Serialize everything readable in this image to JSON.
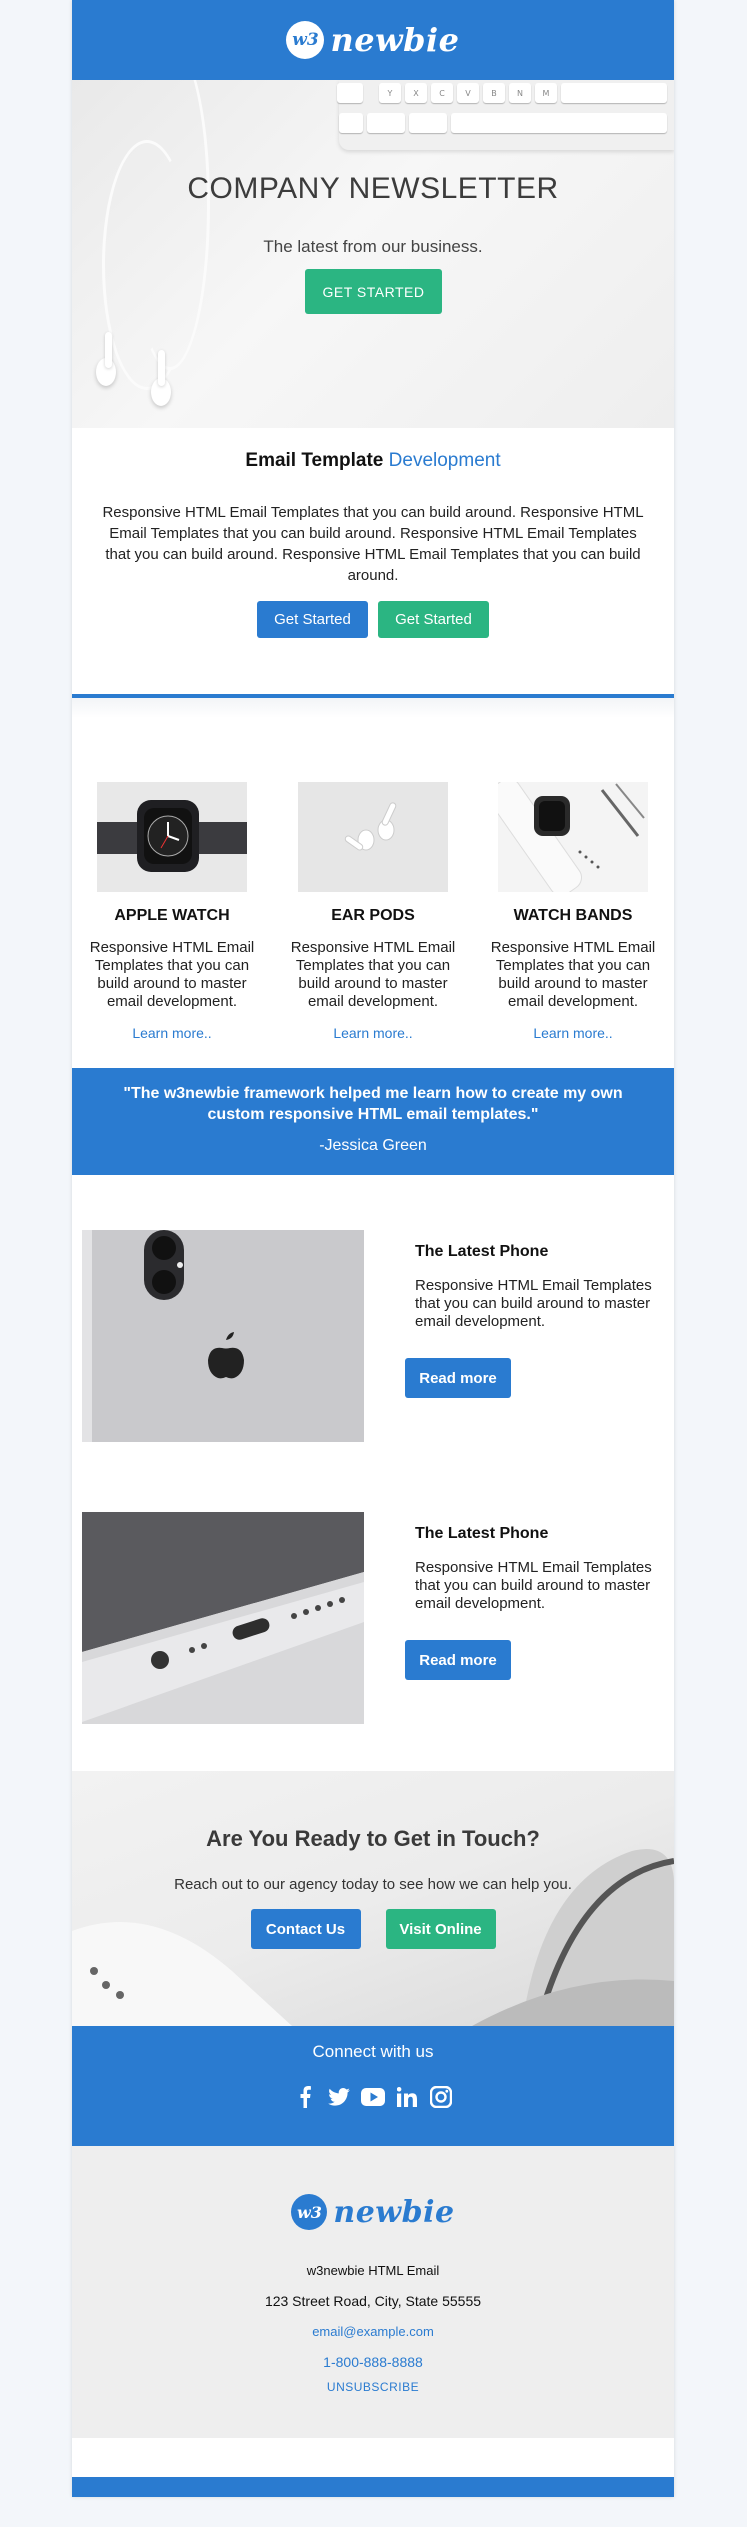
{
  "brand": {
    "logo_badge": "w3",
    "logo_text": "newbie"
  },
  "hero": {
    "title": "COMPANY NEWSLETTER",
    "subtitle": "The latest from our business.",
    "cta": "GET STARTED",
    "keys": [
      "",
      "Y",
      "X",
      "C",
      "V",
      "B",
      "N",
      "M"
    ]
  },
  "intro": {
    "title": "Email Template",
    "title_accent": "Development",
    "body": "Responsive HTML Email Templates that you can build around. Responsive HTML Email Templates that you can build around. Responsive HTML Email Templates that you can build around. Responsive HTML Email Templates that you can build around.",
    "btn_primary": "Get Started",
    "btn_secondary": "Get Started"
  },
  "products": [
    {
      "name": "APPLE WATCH",
      "desc": "Responsive HTML Email Templates that you can build around to master email development.",
      "link": "Learn more.."
    },
    {
      "name": "EAR PODS",
      "desc": "Responsive HTML Email Templates that you can build around to master email development.",
      "link": "Learn more.."
    },
    {
      "name": "WATCH BANDS",
      "desc": "Responsive HTML Email Templates that you can build around to master email development.",
      "link": "Learn more.."
    }
  ],
  "testimonial": {
    "quote": "\"The w3newbie framework helped me learn how to create my own custom responsive HTML email templates.\"",
    "author": "-Jessica Green"
  },
  "features": [
    {
      "title": "The Latest Phone",
      "desc": "Responsive HTML Email Templates that you can build around to master email development.",
      "btn": "Read more"
    },
    {
      "title": "The Latest Phone",
      "desc": "Responsive HTML Email Templates that you can build around to master email development.",
      "btn": "Read more"
    }
  ],
  "contact": {
    "title": "Are You Ready to Get in Touch?",
    "subtitle": "Reach out to our agency today to see how we can help you.",
    "btn_primary": "Contact Us",
    "btn_secondary": "Visit Online"
  },
  "social": {
    "title": "Connect with us",
    "icons": [
      "facebook-icon",
      "twitter-icon",
      "youtube-icon",
      "linkedin-icon",
      "instagram-icon"
    ]
  },
  "footer": {
    "company": "w3newbie HTML Email",
    "address": "123 Street Road, City, State 55555",
    "email": "email@example.com",
    "phone": "1-800-888-8888",
    "unsubscribe": "UNSUBSCRIBE"
  },
  "colors": {
    "primary": "#2a7bd0",
    "accent_green": "#2bb582",
    "footer_bg": "#eeeeee",
    "page_bg": "#f3f6fa"
  }
}
